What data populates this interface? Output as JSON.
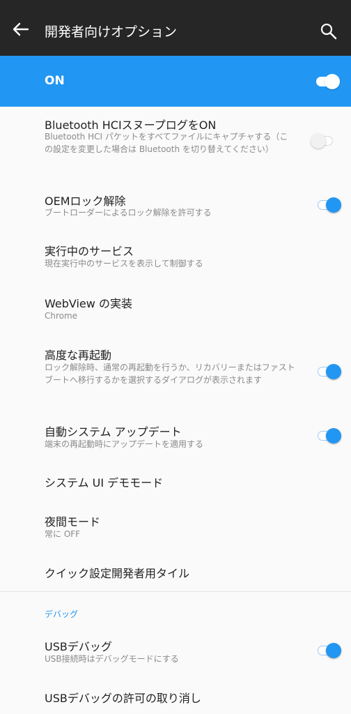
{
  "header": {
    "back_icon": "back-arrow-icon",
    "title": "開発者向けオプション",
    "search_icon": "search-icon"
  },
  "master_switch": {
    "label": "ON",
    "state": true,
    "color": "#2196f3"
  },
  "items": [
    {
      "title": "Bluetooth HCIスヌープログをON",
      "subtitle": "Bluetooth HCI パケットをすべてファイルにキャプチャする（この設定を変更した場合は Bluetooth を切り替えてください）",
      "toggle": false
    },
    {
      "title": "OEMロック解除",
      "subtitle": "ブートローダーによるロック解除を許可する",
      "toggle": true
    },
    {
      "title": "実行中のサービス",
      "subtitle": "現在実行中のサービスを表示して制御する"
    },
    {
      "title": "WebView の実装",
      "subtitle": "Chrome"
    },
    {
      "title": "高度な再起動",
      "subtitle": "ロック解除時、通常の再起動を行うか、リカバリーまたはファストブートへ移行するかを選択するダイアログが表示されます",
      "toggle": true
    },
    {
      "title": "自動システム アップデート",
      "subtitle": "端末の再起動時にアップデートを適用する",
      "toggle": true
    },
    {
      "title": "システム UI デモモード"
    },
    {
      "title": "夜間モード",
      "subtitle": "常に OFF"
    },
    {
      "title": "クイック設定開発者用タイル"
    }
  ],
  "debug_section": {
    "heading": "デバッグ",
    "items": [
      {
        "title": "USBデバッグ",
        "subtitle": "USB接続時はデバッグモードにする",
        "toggle": true
      },
      {
        "title": "USBデバッグの許可の取り消し"
      }
    ]
  }
}
